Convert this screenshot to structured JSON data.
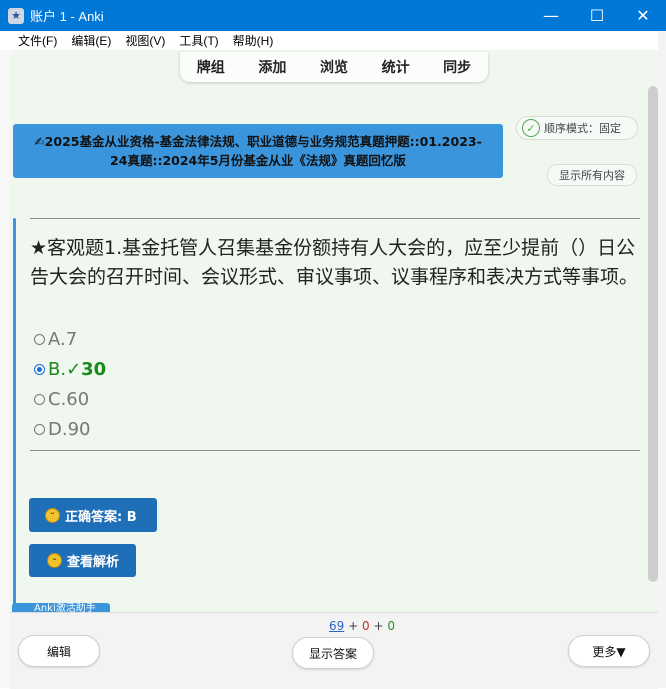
{
  "window": {
    "title": "账户 1 - Anki",
    "controls": {
      "minimize": "—",
      "maximize": "☐",
      "close": "✕"
    }
  },
  "menu": {
    "items": [
      "文件(F)",
      "编辑(E)",
      "视图(V)",
      "工具(T)",
      "帮助(H)"
    ]
  },
  "toolbar": {
    "links": [
      "牌组",
      "添加",
      "浏览",
      "统计",
      "同步"
    ]
  },
  "card": {
    "banner": "✍2025基金从业资格-基金法律法规、职业道德与业务规范真题押题::01.2023-24真题::2024年5月份基金从业《法规》真题回忆版",
    "order_mode": "顺序模式：固定",
    "order_check": "✓",
    "show_all": "显示所有内容",
    "question": "★客观题1.基金托管人召集基金份额持有人大会的，应至少提前（）日公告大会的召开时间、会议形式、审议事项、议事程序和表决方式等事项。",
    "options": [
      {
        "label": "A.7",
        "selected": false,
        "check": ""
      },
      {
        "label": "B.",
        "selected": true,
        "check": "✓30"
      },
      {
        "label": "C.60",
        "selected": false,
        "check": ""
      },
      {
        "label": "D.90",
        "selected": false,
        "check": ""
      }
    ],
    "answer_button": "正确答案: B",
    "explain_button": "查看解析",
    "assist_tab": "Anki激活助手"
  },
  "counts": {
    "new": "69",
    "learn": "0",
    "review": "0",
    "sep": "+"
  },
  "bottom": {
    "edit": "编辑",
    "show_answer": "显示答案",
    "more": "更多▼"
  },
  "colors": {
    "titlebar": "#0078d7",
    "banner": "#3a95dc",
    "blue_button": "#1f6fb8",
    "correct_green": "#1a8a1a",
    "main_bg": "#eff7ef"
  }
}
